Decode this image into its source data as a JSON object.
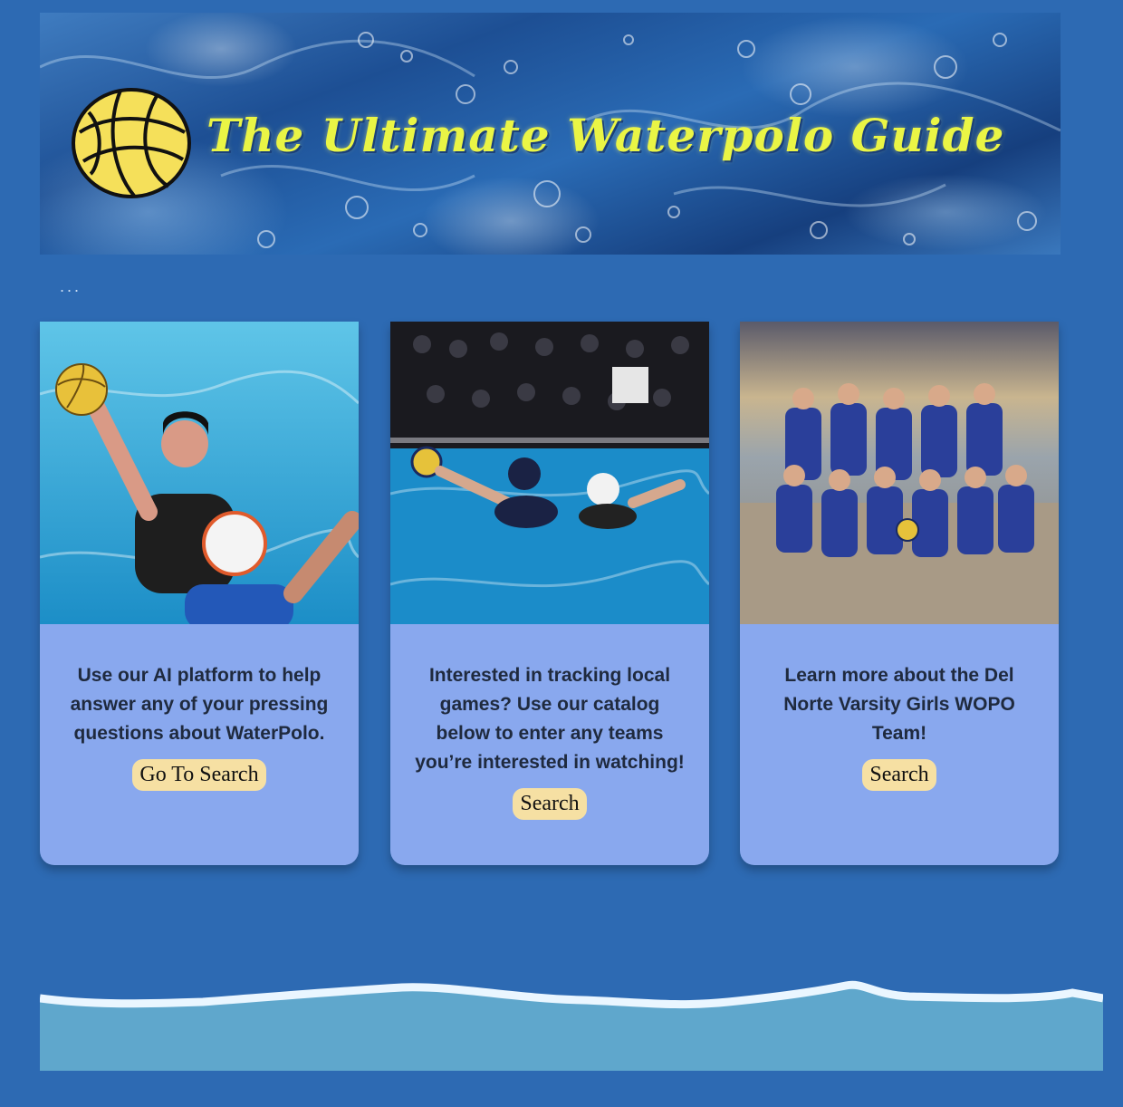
{
  "banner": {
    "title": "The Ultimate Waterpolo Guide",
    "logo_icon": "water-polo-ball-icon"
  },
  "menu": {
    "dots": "..."
  },
  "cards": [
    {
      "photo_icon": "water-polo-player-photo",
      "text": "Use our AI platform to help answer any of your pressing questions about WaterPolo.",
      "button": "Go To Search"
    },
    {
      "photo_icon": "water-polo-game-photo",
      "text": "Interested in tracking local games? Use our catalog below to enter any teams you’re interested in watching!",
      "button": "Search"
    },
    {
      "photo_icon": "team-beach-photo",
      "text": "Learn more about the Del Norte Varsity Girls WOPO Team!",
      "button": "Search"
    }
  ],
  "colors": {
    "background": "#2d6ab3",
    "card": "#89a8ee",
    "button": "#f6e0a3",
    "title": "#eaf545",
    "wave": "#5fa7cc"
  }
}
